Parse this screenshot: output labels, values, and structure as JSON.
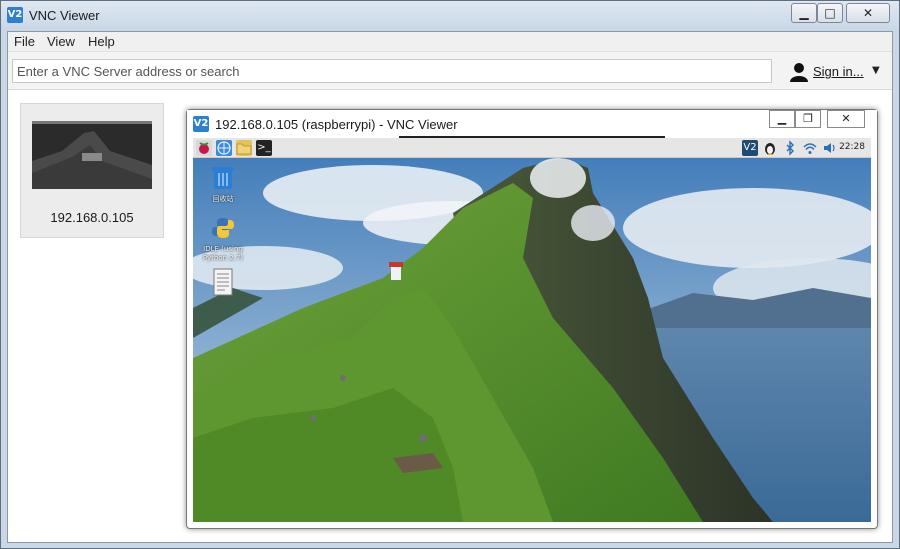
{
  "window": {
    "title": "VNC Viewer",
    "icon_text": "V2",
    "controls": {
      "minimize": "▁",
      "maximize": "□",
      "close": "✕"
    }
  },
  "menu": {
    "items": [
      "File",
      "View",
      "Help"
    ]
  },
  "toolbar": {
    "search_placeholder": "Enter a VNC Server address or search",
    "sign_in_label": "Sign in...",
    "sign_in_caret": "▼"
  },
  "address_book": {
    "tiles": [
      {
        "label": "192.168.0.105"
      }
    ]
  },
  "remote_window": {
    "title": "192.168.0.105 (raspberrypi) - VNC Viewer",
    "icon_text": "V2",
    "controls": {
      "minimize": "▁",
      "restore": "❐",
      "close": "✕"
    },
    "desktop": {
      "panel_clock": "22:28",
      "panel_vnc_text": "V2",
      "panel_terminal_text": ">_",
      "icons": [
        {
          "name": "trash",
          "label": "回收站"
        },
        {
          "name": "idle",
          "label": "IDLE (using Python 2.7)"
        },
        {
          "name": "document",
          "label": ""
        }
      ]
    }
  },
  "colors": {
    "accent": "#2e7fd1",
    "titlebar": "#c8d6e5",
    "panel": "#e6e6e6"
  }
}
